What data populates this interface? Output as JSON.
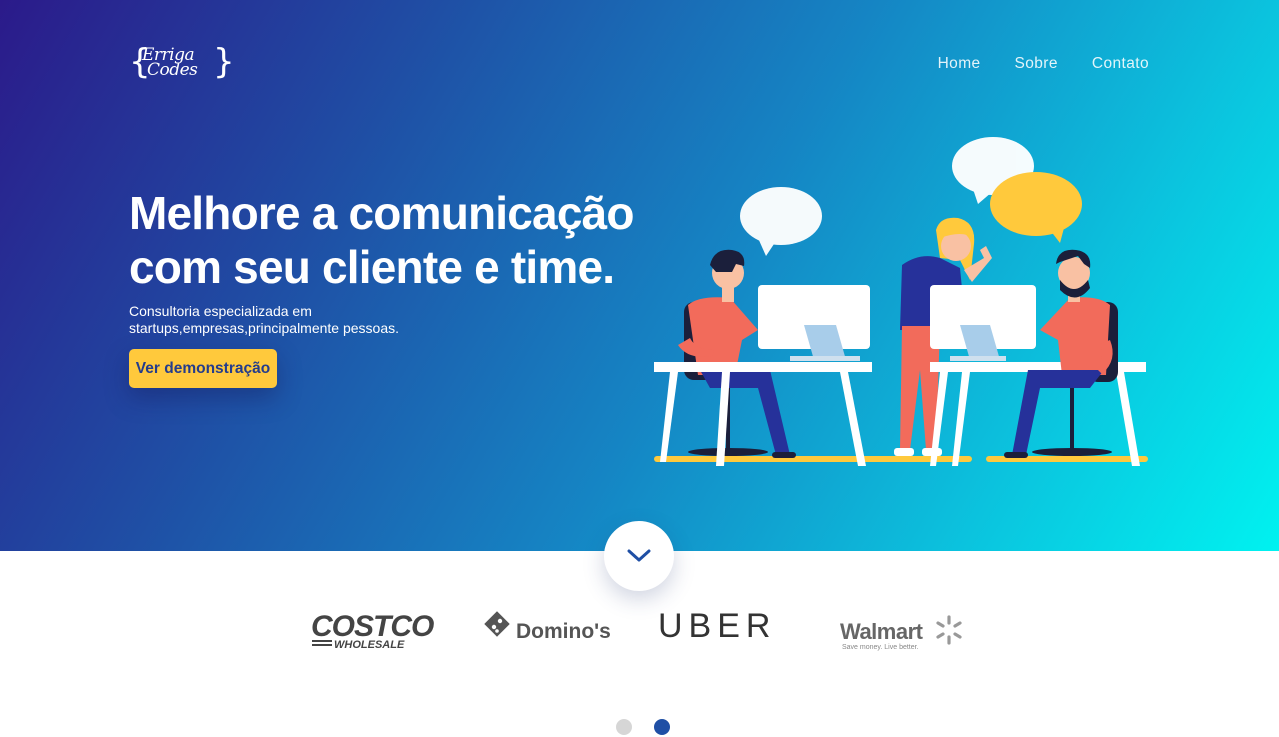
{
  "brand": {
    "line1": "Erriga",
    "line2": "Codes",
    "open_brace": "{",
    "close_brace": "}"
  },
  "nav": {
    "items": [
      "Home",
      "Sobre",
      "Contato"
    ]
  },
  "hero": {
    "headline_line1": "Melhore a comunicação",
    "headline_line2": "com seu cliente e time.",
    "sub_line1": "Consultoria especializada em",
    "sub_line2": "startups,empresas,principalmente pessoas.",
    "cta_label": "Ver demonstração"
  },
  "partners": {
    "costco_main": "COSTCO",
    "costco_sub": "WHOLESALE",
    "dominos": "Domino's",
    "uber": "UBER",
    "walmart": "Walmart",
    "walmart_tagline": "Save money. Live better."
  },
  "carousel": {
    "total": 2,
    "active_index": 1
  },
  "colors": {
    "gradient_start": "#2b1a8a",
    "gradient_end": "#00f2f0",
    "cta_bg": "#ffc93c",
    "cta_text": "#243c8c",
    "dot_active": "#1f4fa5",
    "dot_inactive": "#d6d6d6"
  },
  "icons": {
    "scroll": "chevron-down-icon"
  }
}
